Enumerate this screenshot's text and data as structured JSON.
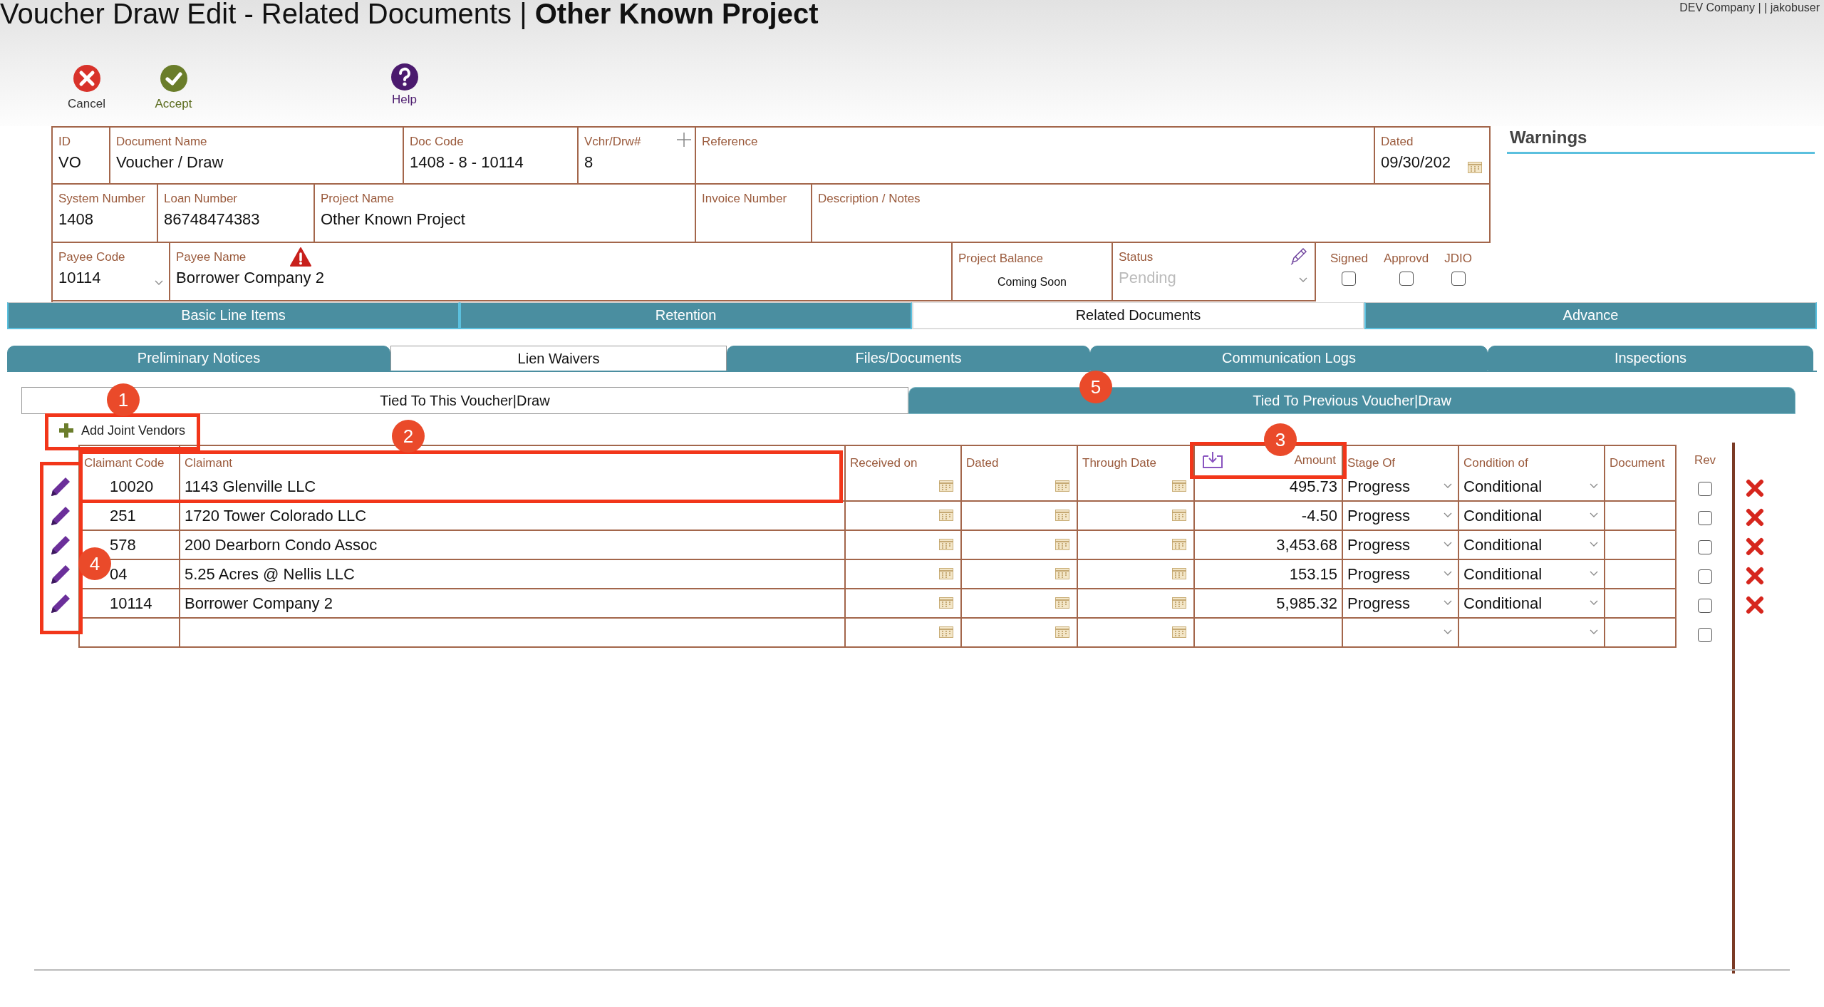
{
  "header": {
    "title": "Voucher Draw Edit - Related Documents | ",
    "project": "Other Known Project",
    "user_info": "DEV Company | | jakobuser"
  },
  "toolbar": [
    {
      "kind": "cancel",
      "label": "Cancel"
    },
    {
      "kind": "accept",
      "label": "Accept"
    },
    {
      "kind": "help",
      "label": "Help"
    }
  ],
  "form": {
    "rows": [
      {
        "fields": [
          {
            "kind": "text",
            "label": "ID",
            "value": "VO"
          },
          {
            "kind": "text",
            "label": "Document Name",
            "value": "Voucher / Draw"
          },
          {
            "kind": "text",
            "label": "Doc Code",
            "value": "1408 - 8 - 10114"
          },
          {
            "kind": "counter",
            "label": "Vchr/Drw#",
            "value": "8"
          },
          {
            "kind": "text",
            "label": "Reference"
          },
          {
            "kind": "date",
            "label": "Dated",
            "value": "09/30/202"
          }
        ]
      },
      {
        "fields": [
          {
            "kind": "text",
            "label": "System Number",
            "value": "1408"
          },
          {
            "kind": "text",
            "label": "Loan Number",
            "value": "86748474383"
          },
          {
            "kind": "text",
            "label": "Project Name",
            "value": "Other Known Project"
          },
          {
            "kind": "text",
            "label": "Invoice Number"
          },
          {
            "kind": "text",
            "label": "Description / Notes"
          }
        ]
      },
      {
        "fields": [
          {
            "kind": "select",
            "label": "Payee Code",
            "value": "10114"
          },
          {
            "kind": "warning",
            "label": "Payee Name",
            "value": "Borrower Company 2"
          },
          {
            "kind": "note",
            "label": "Project Balance",
            "value": "Coming Soon"
          },
          {
            "kind": "status",
            "label": "Status",
            "placeholder": "Pending"
          }
        ]
      }
    ],
    "flags": [
      {
        "label": "Signed",
        "checked": false
      },
      {
        "label": "Approvd",
        "checked": false
      },
      {
        "label": "JDIO",
        "checked": false
      }
    ]
  },
  "warnings": {
    "title": "Warnings"
  },
  "main_tabs": [
    {
      "label": "Basic Line Items",
      "selected": false
    },
    {
      "label": "Retention",
      "selected": false
    },
    {
      "label": "Related Documents",
      "selected": true
    },
    {
      "label": "Advance",
      "selected": false
    }
  ],
  "sub_tabs": [
    {
      "label": "Preliminary Notices",
      "selected": false
    },
    {
      "label": "Lien Waivers",
      "selected": true
    },
    {
      "label": "Files/Documents",
      "selected": false
    },
    {
      "label": "Communication Logs",
      "selected": false
    },
    {
      "label": "Inspections",
      "selected": false
    }
  ],
  "scope_tabs": [
    {
      "label": "Tied To This Voucher|Draw",
      "selected": true
    },
    {
      "label": "Tied To Previous Voucher|Draw",
      "selected": false
    }
  ],
  "add_button": {
    "label": "Add Joint Vendors"
  },
  "table": {
    "columns": [
      "Claimant Code",
      "Claimant",
      "Received on",
      "Dated",
      "Through Date",
      "Amount",
      "Stage Of",
      "Condition of",
      "Document"
    ],
    "rev_label": "Rev",
    "rows": [
      {
        "editable": true,
        "code": "10020",
        "claimant": "1143 Glenville LLC",
        "amount": "495.73",
        "stage": "Progress",
        "condition": "Conditional",
        "rev": false
      },
      {
        "editable": true,
        "code": "251",
        "claimant": "1720 Tower Colorado LLC",
        "amount": "-4.50",
        "stage": "Progress",
        "condition": "Conditional",
        "rev": false
      },
      {
        "editable": true,
        "code": "578",
        "claimant": "200 Dearborn Condo Assoc",
        "amount": "3,453.68",
        "stage": "Progress",
        "condition": "Conditional",
        "rev": false
      },
      {
        "editable": true,
        "code": "04",
        "claimant": "5.25 Acres @ Nellis LLC",
        "amount": "153.15",
        "stage": "Progress",
        "condition": "Conditional",
        "rev": false
      },
      {
        "editable": true,
        "code": "10114",
        "claimant": "Borrower Company 2",
        "amount": "5,985.32",
        "stage": "Progress",
        "condition": "Conditional",
        "rev": false
      },
      {
        "editable": false,
        "rev": false
      }
    ]
  },
  "annotations": [
    {
      "number": "1"
    },
    {
      "number": "2"
    },
    {
      "number": "3"
    },
    {
      "number": "4"
    },
    {
      "number": "5"
    }
  ]
}
